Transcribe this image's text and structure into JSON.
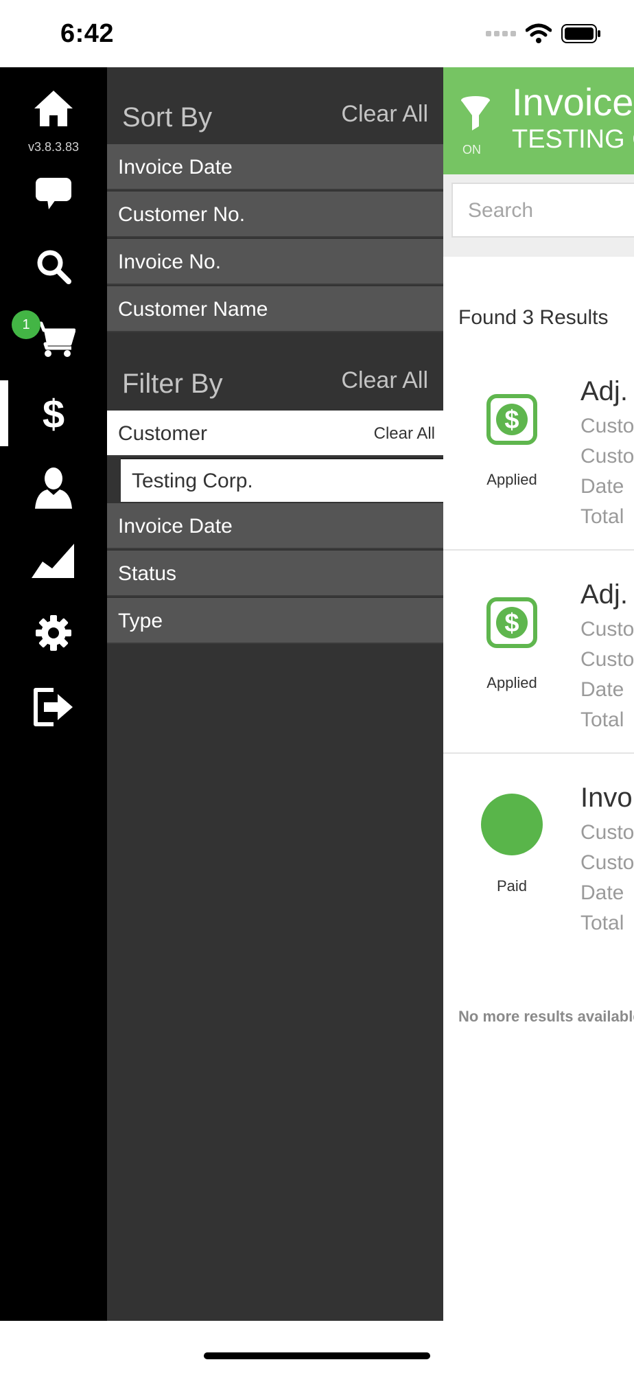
{
  "status_bar": {
    "time": "6:42"
  },
  "rail": {
    "version": "v3.8.3.83",
    "cart_badge": "1",
    "items": [
      {
        "icon": "home-icon"
      },
      {
        "icon": "chat-icon"
      },
      {
        "icon": "search-icon"
      },
      {
        "icon": "cart-icon"
      },
      {
        "icon": "dollar-icon"
      },
      {
        "icon": "user-icon"
      },
      {
        "icon": "chart-icon"
      },
      {
        "icon": "gear-icon"
      },
      {
        "icon": "logout-icon"
      }
    ]
  },
  "sort": {
    "title": "Sort By",
    "clear_label": "Clear All",
    "options": [
      "Invoice Date",
      "Customer No.",
      "Invoice No.",
      "Customer Name"
    ]
  },
  "filter": {
    "title": "Filter By",
    "clear_label": "Clear All",
    "customer": {
      "label": "Customer",
      "clear_label": "Clear All",
      "selected_value": "Testing Corp."
    },
    "options": [
      "Invoice Date",
      "Status",
      "Type"
    ]
  },
  "main": {
    "filter_state": "ON",
    "header_title": "Invoices",
    "header_subtitle": "TESTING CORP.",
    "search_placeholder": "Search",
    "found_text": "Found 3 Results",
    "results": [
      {
        "status": "Applied",
        "title": "Adj.",
        "lines": [
          "Custo",
          "Custo",
          "Date",
          "Total"
        ]
      },
      {
        "status": "Applied",
        "title": "Adj.",
        "lines": [
          "Custo",
          "Custo",
          "Date",
          "Total"
        ]
      },
      {
        "status": "Paid",
        "title": "Invo",
        "lines": [
          "Custo",
          "Custo",
          "Date",
          "Total"
        ]
      }
    ],
    "no_more_text": "No more results available"
  },
  "colors": {
    "accent_green": "#76c463",
    "badge_green": "#43b545",
    "panel_bg": "#333333",
    "row_bg": "#555555"
  }
}
